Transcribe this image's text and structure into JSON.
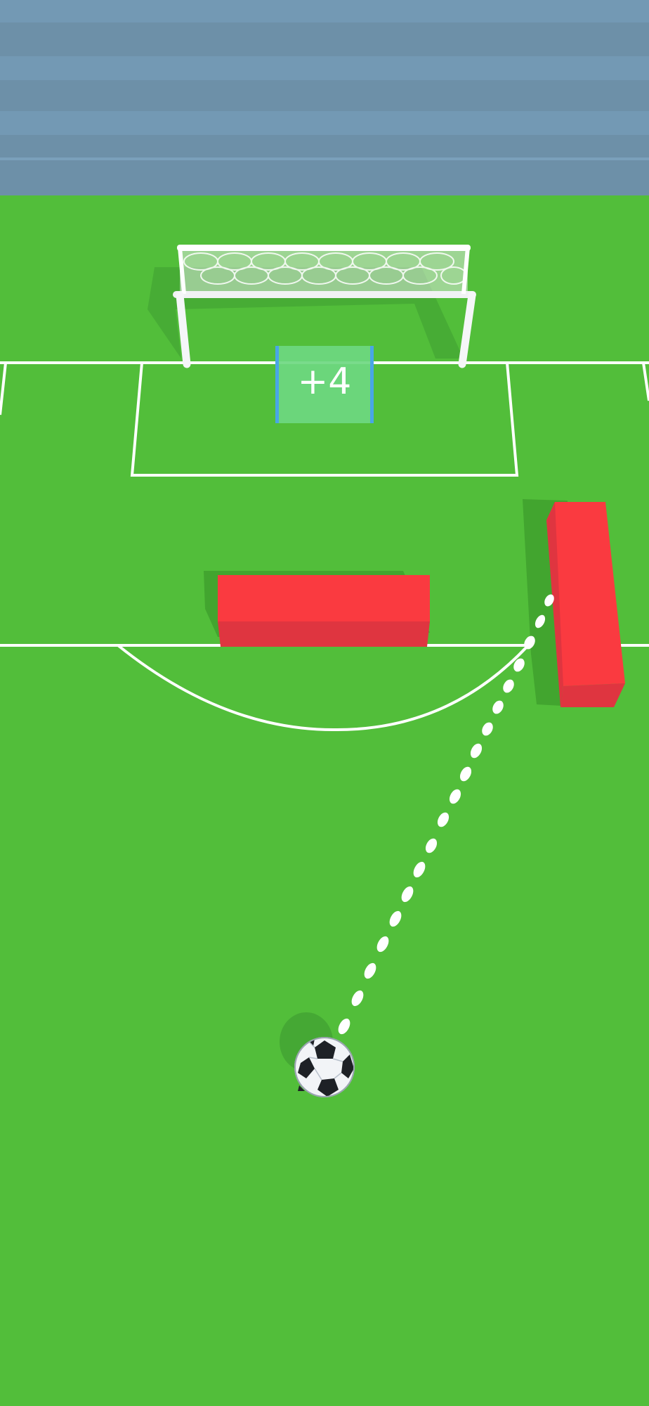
{
  "game": {
    "title": "",
    "multiplier_gate": {
      "label": "+4"
    }
  },
  "colors": {
    "stands_light": "#7399b4",
    "stands_dark": "#6a8ea5",
    "pitch": "#52be3a",
    "pitch_shadow": "#42a52f",
    "lines": "#ffffff",
    "obstacle": "#fa3a40",
    "obstacle_dark": "#df3540",
    "gate_fill": "#6ed881",
    "gate_edge": "#49a6e6",
    "ball_white": "#f2f4f7",
    "ball_black": "#1e2126"
  },
  "objects": [
    {
      "name": "goal",
      "icon": "goal-net-icon"
    },
    {
      "name": "multiplier-gate",
      "icon": "plus-gate-icon"
    },
    {
      "name": "wall-obstacle-center",
      "icon": "red-block-icon"
    },
    {
      "name": "wall-obstacle-right",
      "icon": "red-block-icon"
    },
    {
      "name": "soccer-ball",
      "icon": "soccer-ball-icon"
    },
    {
      "name": "aim-trajectory",
      "icon": "dotted-path-icon"
    }
  ]
}
